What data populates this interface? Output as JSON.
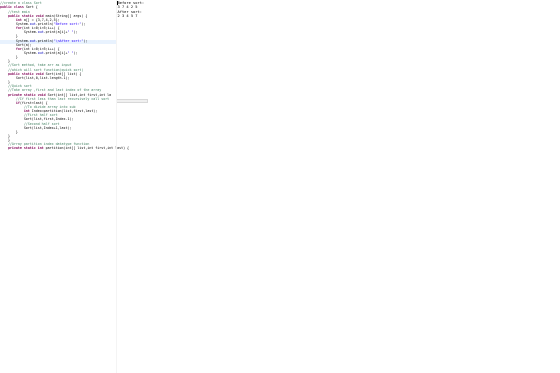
{
  "colors": {
    "keyword": "#7f0055",
    "comment": "#3f7f5f",
    "string": "#2a00ff",
    "field": "#0000c0",
    "plain": "#000000",
    "highlight": "#e8f2fe"
  },
  "editor": {
    "lines": [
      [
        {
          "t": "//create a class Sort",
          "c": "comment"
        }
      ],
      [
        {
          "t": "public class ",
          "c": "keyword"
        },
        {
          "t": "Sort {",
          "c": "plain"
        }
      ],
      [
        {
          "t": "    //test main",
          "c": "comment"
        }
      ],
      [
        {
          "t": "    public static void ",
          "c": "keyword"
        },
        {
          "t": "main(String[] args) {",
          "c": "plain"
        }
      ],
      [
        {
          "t": "        int",
          "c": "keyword"
        },
        {
          "t": " a[] = {3,7,4,2,5};",
          "c": "plain"
        }
      ],
      [
        {
          "t": "        System.",
          "c": "plain"
        },
        {
          "t": "out",
          "c": "field"
        },
        {
          "t": ".println(",
          "c": "plain"
        },
        {
          "t": "\"Before sort:\"",
          "c": "string"
        },
        {
          "t": ");",
          "c": "plain"
        }
      ],
      [
        {
          "t": "        for",
          "c": "keyword"
        },
        {
          "t": "(int i=0;i<5;i++) {",
          "c": "plain"
        }
      ],
      [
        {
          "t": "            System.",
          "c": "plain"
        },
        {
          "t": "out",
          "c": "field"
        },
        {
          "t": ".print(a[i]+",
          "c": "plain"
        },
        {
          "t": "\" \"",
          "c": "string"
        },
        {
          "t": ");",
          "c": "plain"
        }
      ],
      [
        {
          "t": "        }",
          "c": "plain"
        }
      ],
      [
        {
          "t": "        System.",
          "c": "plain"
        },
        {
          "t": "out",
          "c": "field"
        },
        {
          "t": ".println(",
          "c": "plain"
        },
        {
          "t": "\"\\nAfter sort:\"",
          "c": "string"
        },
        {
          "t": ");",
          "c": "plain"
        }
      ],
      [
        {
          "t": "        Sort(a);",
          "c": "plain"
        }
      ],
      [
        {
          "t": "        for",
          "c": "keyword"
        },
        {
          "t": "(int i=0;i<5;i++) {",
          "c": "plain"
        }
      ],
      [
        {
          "t": "            System.",
          "c": "plain"
        },
        {
          "t": "out",
          "c": "field"
        },
        {
          "t": ".print(a[i]+",
          "c": "plain"
        },
        {
          "t": "\" \"",
          "c": "string"
        },
        {
          "t": ");",
          "c": "plain"
        }
      ],
      [
        {
          "t": "        }",
          "c": "plain"
        }
      ],
      [
        {
          "t": "    }",
          "c": "plain"
        }
      ],
      [
        {
          "t": "    //Sort method, take arr as input",
          "c": "comment"
        }
      ],
      [
        {
          "t": "    //which will sort function(quick sort)",
          "c": "comment"
        }
      ],
      [
        {
          "t": "    public static void ",
          "c": "keyword"
        },
        {
          "t": "Sort(int[] list) {",
          "c": "plain"
        }
      ],
      [
        {
          "t": "        Sort(list,0,list.length-1);",
          "c": "plain"
        }
      ],
      [
        {
          "t": "    }",
          "c": "plain"
        }
      ],
      [
        {
          "t": "    //Quick sort",
          "c": "comment"
        }
      ],
      [
        {
          "t": "    //Take array ,first and last index of the array",
          "c": "comment"
        }
      ],
      [
        {
          "t": "    private static void ",
          "c": "keyword"
        },
        {
          "t": "Sort(int[] list,int first,int la",
          "c": "plain"
        }
      ],
      [
        {
          "t": "        //If first less than last recursively call sort",
          "c": "comment"
        }
      ],
      [
        {
          "t": "        if",
          "c": "keyword"
        },
        {
          "t": "(first<last) {",
          "c": "plain"
        }
      ],
      [
        {
          "t": "            //To divide array into sub",
          "c": "comment"
        }
      ],
      [
        {
          "t": "            int",
          "c": "keyword"
        },
        {
          "t": " Index=partition(list,first,last);",
          "c": "plain"
        }
      ],
      [
        {
          "t": "            //First half sort",
          "c": "comment"
        }
      ],
      [
        {
          "t": "            Sort(list,first,Index-1);",
          "c": "plain"
        }
      ],
      [
        {
          "t": "            //Second half sort",
          "c": "comment"
        }
      ],
      [
        {
          "t": "            Sort(list,Index+1,last);",
          "c": "plain"
        }
      ],
      [
        {
          "t": "        }",
          "c": "plain"
        }
      ],
      [
        {
          "t": "    }",
          "c": "plain"
        }
      ],
      [
        {
          "t": "    }",
          "c": "plain"
        }
      ],
      [
        {
          "t": "    //Array partition index datatype function",
          "c": "comment"
        }
      ],
      [
        {
          "t": "    private static int ",
          "c": "keyword"
        },
        {
          "t": "partition(int[] list,int first,int last) {",
          "c": "plain"
        }
      ]
    ]
  },
  "console": {
    "lines": [
      "Before sort:",
      "3 7 4 2 5",
      "After sort:",
      "2 3 4 5 7"
    ]
  }
}
